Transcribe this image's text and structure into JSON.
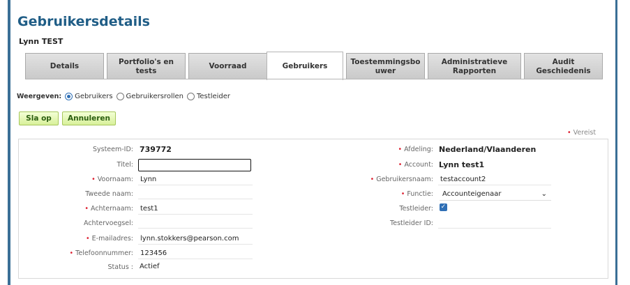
{
  "page": {
    "title": "Gebruikersdetails",
    "user_name": "Lynn TEST"
  },
  "tabs": [
    {
      "line1": "Details",
      "line2": ""
    },
    {
      "line1": "Portfolio's en",
      "line2": "tests"
    },
    {
      "line1": "Voorraad",
      "line2": ""
    },
    {
      "line1": "Gebruikers",
      "line2": ""
    },
    {
      "line1": "Toestemmingsbo",
      "line2": "uwer"
    },
    {
      "line1": "Administratieve",
      "line2": "Rapporten"
    },
    {
      "line1": "Audit",
      "line2": "Geschiedenis"
    }
  ],
  "active_tab": "Gebruikers",
  "view": {
    "label": "Weergeven:",
    "options": [
      "Gebruikers",
      "Gebruikersrollen",
      "Testleider"
    ],
    "selected": "Gebruikers"
  },
  "actions": {
    "save": "Sla op",
    "cancel": "Annuleren"
  },
  "required_note": {
    "marker": "•",
    "text": "Vereist"
  },
  "left_fields": {
    "system_id": {
      "label": "Systeem-ID:",
      "value": "739772"
    },
    "title": {
      "label": "Titel:",
      "value": ""
    },
    "first_name": {
      "label": "Voornaam:",
      "value": "Lynn"
    },
    "middle_name": {
      "label": "Tweede naam:",
      "value": ""
    },
    "last_name": {
      "label": "Achternaam:",
      "value": "test1"
    },
    "suffix": {
      "label": "Achtervoegsel:",
      "value": ""
    },
    "email": {
      "label": "E-mailadres:",
      "value": "lynn.stokkers@pearson.com"
    },
    "phone": {
      "label": "Telefoonnummer:",
      "value": "123456"
    },
    "status": {
      "label": "Status :",
      "value": "Actief"
    }
  },
  "right_fields": {
    "department": {
      "label": "Afdeling:",
      "value": "Nederland/Vlaanderen"
    },
    "account": {
      "label": "Account:",
      "value": "Lynn test1"
    },
    "username": {
      "label": "Gebruikersnaam:",
      "value": "testaccount2"
    },
    "function": {
      "label": "Functie:",
      "value": "Accounteigenaar"
    },
    "test_leader": {
      "label": "Testleider:",
      "checked": true
    },
    "test_leader_id": {
      "label": "Testleider ID:",
      "value": ""
    }
  },
  "colors": {
    "title": "#1f5d86",
    "accent_bar": "#3a6f96",
    "required": "#dd2233",
    "button_bg": "#d8f09a"
  }
}
